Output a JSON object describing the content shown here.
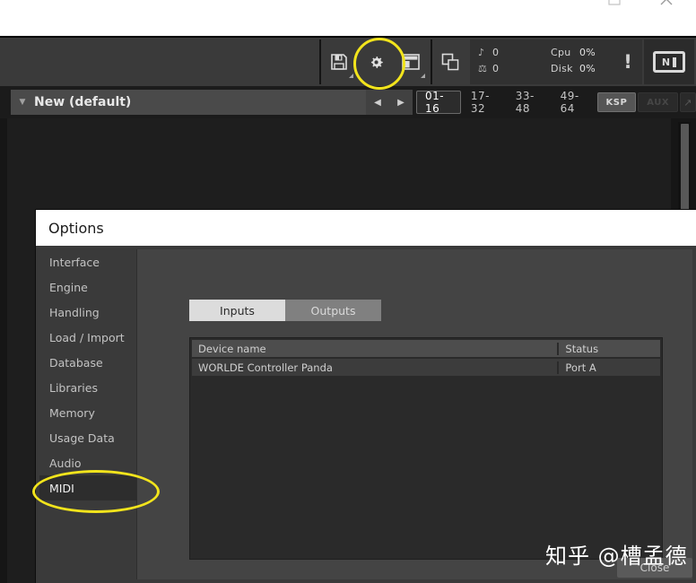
{
  "window_controls": {
    "maximize_icon": "maximize-icon",
    "close_icon": "close-icon"
  },
  "toolbar": {
    "save_icon": "floppy-disk-save-icon",
    "options_icon": "gear-options-icon",
    "view_icon": "panel-layout-icon",
    "multi_icon": "window-stack-icon",
    "voices_icon": "note-icon",
    "voices_value": "0",
    "memory_icon": "memory-icon",
    "memory_value": "0",
    "cpu_label": "Cpu",
    "cpu_value": "0%",
    "disk_label": "Disk",
    "disk_value": "0%",
    "warning_icon": "exclamation-icon",
    "logo": {
      "letter_n": "N",
      "name": "ni-logo"
    }
  },
  "rack": {
    "dropdown_caret": "caret-down-icon",
    "instrument_name": "New (default)",
    "prev_icon": "◀",
    "next_icon": "▶",
    "banks": [
      {
        "label": "01-16",
        "state": "active"
      },
      {
        "label": "17-32",
        "state": "normal"
      },
      {
        "label": "33-48",
        "state": "normal"
      },
      {
        "label": "49-64",
        "state": "normal"
      }
    ],
    "ksp_label": "KSP",
    "aux_label": "AUX",
    "expand_icon": "↗"
  },
  "options": {
    "title": "Options",
    "sidebar": [
      {
        "label": "Interface",
        "selected": false
      },
      {
        "label": "Engine",
        "selected": false
      },
      {
        "label": "Handling",
        "selected": false
      },
      {
        "label": "Load / Import",
        "selected": false
      },
      {
        "label": "Database",
        "selected": false
      },
      {
        "label": "Libraries",
        "selected": false
      },
      {
        "label": "Memory",
        "selected": false
      },
      {
        "label": "Usage Data",
        "selected": false
      },
      {
        "label": "Audio",
        "selected": false
      },
      {
        "label": "MIDI",
        "selected": true
      }
    ],
    "tabs": [
      {
        "label": "Inputs",
        "active": true
      },
      {
        "label": "Outputs",
        "active": false
      }
    ],
    "table": {
      "headers": [
        "Device name",
        "Status"
      ],
      "rows": [
        {
          "device_name": "WORLDE Controller Panda",
          "status": "Port A"
        }
      ]
    },
    "close_label": "Close"
  },
  "annotations": {
    "accent_color": "#f2e41c",
    "gear_highlight": "gear-options-icon",
    "midi_highlight": "sidebar-item-midi"
  },
  "watermark": {
    "text": "知乎 @槽孟德"
  }
}
